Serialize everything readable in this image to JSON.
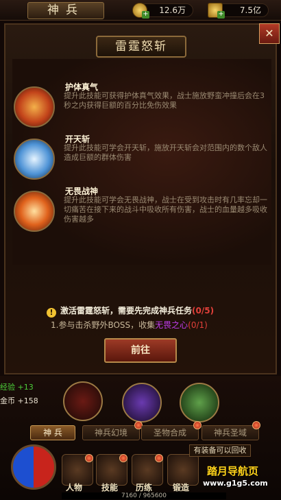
{
  "header": {
    "title": "神兵",
    "coins": "12.6万",
    "ingots": "7.5亿"
  },
  "skill_panel": {
    "title": "雷霆怒斩",
    "skills": [
      {
        "name": "护体真气",
        "desc": "提升此技能可获得护体真气效果，战士施放野蛮冲撞后会在3秒之内获得巨额的百分比免伤效果",
        "icon": "flame-swirl-icon"
      },
      {
        "name": "开天斩",
        "desc": "提升此技能可学会开天斩，施放开天斩会对范围内的数个敌人造成巨额的群体伤害",
        "icon": "ice-blade-icon"
      },
      {
        "name": "无畏战神",
        "desc": "提升此技能可学会无畏战神，战士在受到攻击时有几率忘却一切痛苦在接下来的战斗中吸收所有伤害，战士的血量越多吸收伤害越多",
        "icon": "fire-orb-icon"
      }
    ],
    "activate_text": "激活雷霆怒斩，需要先完成神兵任务",
    "activate_count": "(0/5)",
    "task_prefix": "1.参与击杀野外BOSS，收集",
    "task_item": "无畏之心",
    "task_count": "(0/1)",
    "go_label": "前往"
  },
  "stats": {
    "exp": "经验 +13",
    "gold": "金币  +158"
  },
  "tabs": [
    "神 兵",
    "神兵幻境",
    "圣物合成",
    "神兵圣域"
  ],
  "nav": [
    "人物",
    "技能",
    "历练",
    "锻造"
  ],
  "tooltip": "有装备可以回收",
  "xp": "7160 / 965600",
  "watermark": {
    "title": "踏月导航页",
    "url": "www.g1g5.com"
  }
}
